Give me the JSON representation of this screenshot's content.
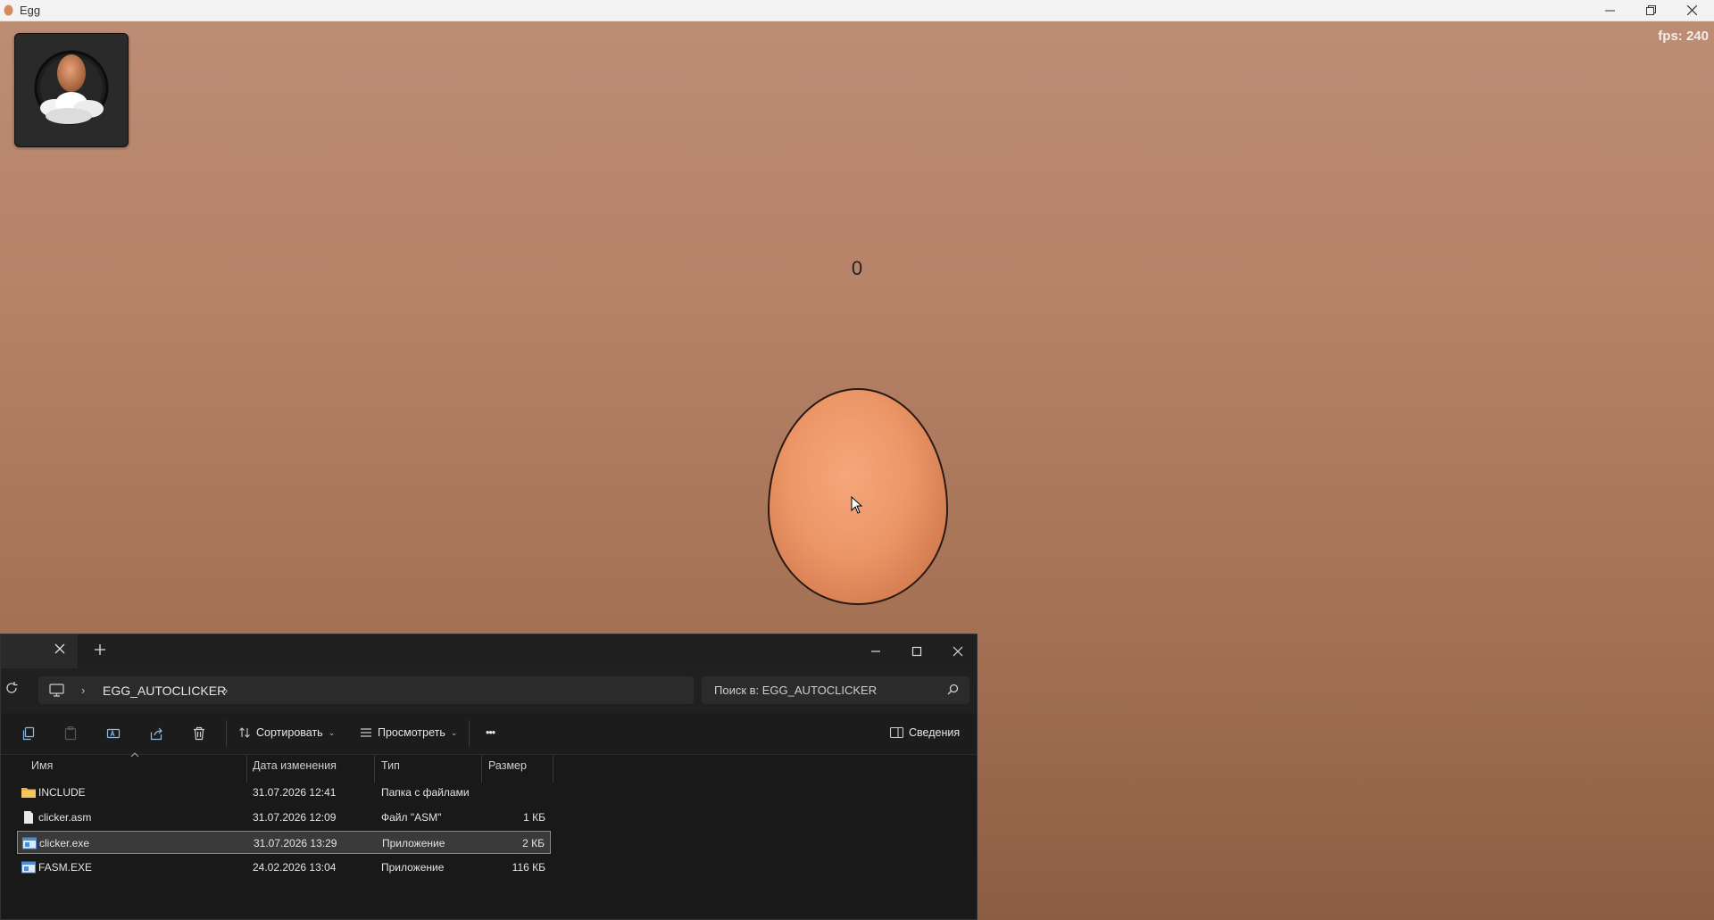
{
  "window": {
    "title": "Egg"
  },
  "game": {
    "fps_label": "fps: 240",
    "counter": "0"
  },
  "explorer": {
    "breadcrumb": "EGG_AUTOCLICKER",
    "search_placeholder": "Поиск в: EGG_AUTOCLICKER",
    "toolbar": {
      "sort_label": "Сортировать",
      "view_label": "Просмотреть",
      "more_label": "•••",
      "details_label": "Сведения"
    },
    "columns": {
      "name": "Имя",
      "modified": "Дата изменения",
      "type": "Тип",
      "size": "Размер"
    },
    "files": [
      {
        "name": "INCLUDE",
        "modified": "31.07.2026 12:41",
        "type": "Папка с файлами",
        "size": "",
        "icon": "folder-icon"
      },
      {
        "name": "clicker.asm",
        "modified": "31.07.2026 12:09",
        "type": "Файл \"ASM\"",
        "size": "1 КБ",
        "icon": "file-icon"
      },
      {
        "name": "clicker.exe",
        "modified": "31.07.2026 13:29",
        "type": "Приложение",
        "size": "2 КБ",
        "icon": "exe-icon",
        "selected": true
      },
      {
        "name": "FASM.EXE",
        "modified": "24.02.2026 13:04",
        "type": "Приложение",
        "size": "116 КБ",
        "icon": "exe-icon"
      }
    ]
  },
  "colors": {
    "egg": "#ec9667",
    "background": "#b78369",
    "explorer_bg": "#191919"
  }
}
